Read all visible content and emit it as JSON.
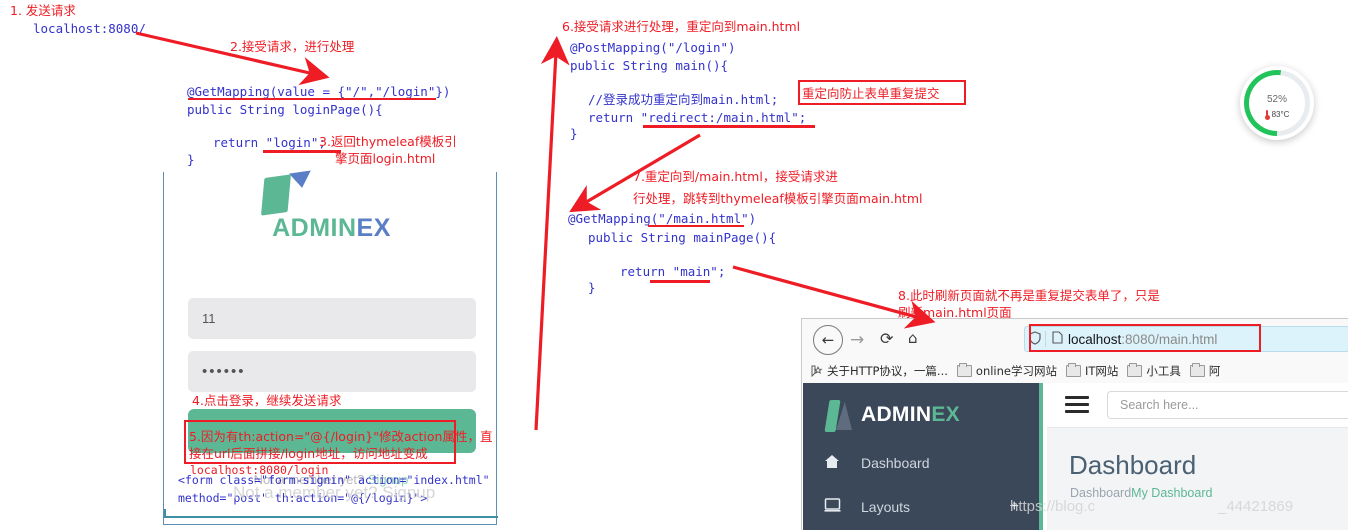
{
  "annotations": {
    "step1_label": "1. 发送请求",
    "step1_url": "localhost:8080/",
    "step2": "2.接受请求，进行处理",
    "step3": "3.返回thymeleaf模板引",
    "step3b": "擎页面login.html",
    "step4": "4.点击登录，继续发送请求",
    "step5a": "5.因为有th:action=\"@{/login}\"修改action属性，直",
    "step5b": "接在url后面拼接/login地址，访问地址变成",
    "step5c": "localhost:8080/login",
    "step6": "6.接受请求进行处理，重定向到main.html",
    "step6_box": "重定向防止表单重复提交",
    "step7a": "7.重定向到/main.html，接受请求进",
    "step7b": "行处理，跳转到thymeleaf模板引擎页面main.html",
    "step8a": "8.此时刷新页面就不再是重复提交表单了，只是",
    "step8b": "刷新main.html页面"
  },
  "code": {
    "login_mapping": "@GetMapping(value = {\"/\",\"/login\"})",
    "login_signature": "public String loginPage(){",
    "login_return": "return \"login\";",
    "login_close": "}",
    "post_mapping": "@PostMapping(\"/login\")",
    "post_signature": "public String main(){",
    "post_comment": "//登录成功重定向到main.html;",
    "post_return": "return \"redirect:/main.html\";",
    "post_close": "}",
    "main_mapping": "@GetMapping(\"/main.html\")",
    "main_signature": "public String mainPage(){",
    "main_return": "return \"main\";",
    "main_close": "}",
    "form_line1": "<form class=\"form-signin\" action=\"index.html\"",
    "form_line2": "method=\"post\" th:action=\"@{/login}\">"
  },
  "login_card": {
    "logo_admin": "ADMIN",
    "logo_ex": "EX",
    "username_value": "11",
    "password_value": "••••••",
    "signup_prefix": "Not a member yet? ",
    "signup_link": "Signup"
  },
  "gauge": {
    "percent": "52",
    "percent_unit": "%",
    "temperature": "83°C",
    "accent_color": "#22c35a",
    "track_color": "#e9ecef"
  },
  "browser": {
    "back_icon": "←",
    "forward_icon": "→",
    "reload_icon": "⟳",
    "home_icon": "⌂",
    "shield_icon": "shield",
    "page_icon": "page",
    "url_host": "localhost",
    "url_rest": ":8080/main.html",
    "bookmarks": [
      {
        "label": "关于HTTP协议，一篇...",
        "icon": "bookmark-star"
      },
      {
        "label": "online学习网站",
        "icon": "folder"
      },
      {
        "label": "IT网站",
        "icon": "folder"
      },
      {
        "label": "小工具",
        "icon": "folder"
      },
      {
        "label": "阿",
        "icon": "folder"
      }
    ]
  },
  "dashboard": {
    "logo_admin": "ADMIN",
    "logo_ex": "EX",
    "nav": [
      {
        "label": "Dashboard",
        "icon": "home-icon",
        "expand": ""
      },
      {
        "label": "Layouts",
        "icon": "monitor-icon",
        "expand": "+"
      }
    ],
    "search_placeholder": "Search here...",
    "page_title": "Dashboard",
    "breadcrumb_root": "Dashboard",
    "breadcrumb_current": "My Dashboard"
  },
  "watermarks": {
    "w1": "Not a member yet? Signup",
    "w2": "https://blog.c",
    "w3": "_44421869"
  },
  "colors": {
    "red": "#ee1c25",
    "code_blue": "#3333cc",
    "green": "#5cb894",
    "sidebar": "#3b4859",
    "card_border": "#5b8fb0"
  }
}
